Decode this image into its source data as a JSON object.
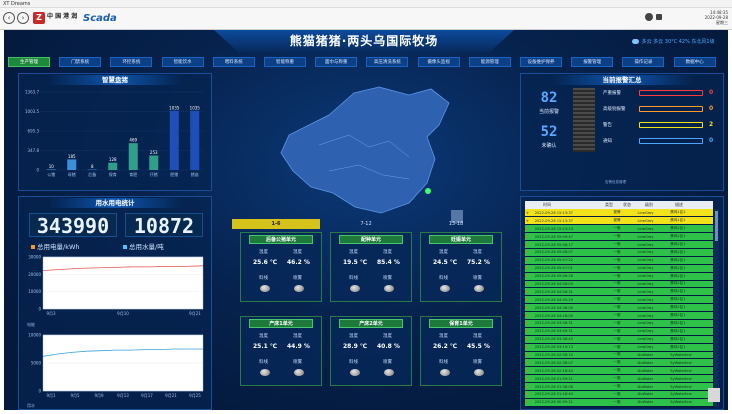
{
  "window": {
    "title": "XT Dreams"
  },
  "navbar": {
    "back_icon": "arrow-left-icon",
    "forward_icon": "arrow-right-icon",
    "logo_cn": "中 国 港 润",
    "logo_scada": "Scada",
    "time": "14:48:35",
    "date": "2022-09-28",
    "weekday": "星期三"
  },
  "header": {
    "title": "熊猫猪猪·两头乌国际牧场",
    "weather": "多云 多云 30°C 42% 东北风1级"
  },
  "tabs": [
    {
      "label": "生产管理",
      "active": true
    },
    {
      "label": "门禁系统",
      "active": false
    },
    {
      "label": "环控系统",
      "active": false
    },
    {
      "label": "智能饮水",
      "active": false
    },
    {
      "label": "喂料系统",
      "active": false
    },
    {
      "label": "智能称重",
      "active": false
    },
    {
      "label": "面巾与称重",
      "active": false
    },
    {
      "label": "高压清洗系统",
      "active": false
    },
    {
      "label": "摄像头监视",
      "active": false
    },
    {
      "label": "能源管理",
      "active": false
    },
    {
      "label": "设备维护保养",
      "active": false
    },
    {
      "label": "报警管理",
      "active": false
    },
    {
      "label": "操作记录",
      "active": false
    },
    {
      "label": "数据中心",
      "active": false
    }
  ],
  "inventory_panel": {
    "title": "智慧盘猪",
    "chart_data": {
      "type": "bar",
      "categories": [
        "公猪",
        "母猪",
        "后备",
        "保育",
        "育肥",
        "仔猪",
        "肥猪",
        "猪苗"
      ],
      "values": [
        10,
        185,
        8,
        128,
        469,
        253,
        1035,
        1035
      ],
      "y_ticks": [
        "1363.7",
        "1003.5",
        "695.3",
        "347.8",
        "0"
      ],
      "ylim": [
        0,
        1363.7
      ]
    }
  },
  "utility_panel": {
    "title": "用水用电统计",
    "power_value": "343990",
    "water_value": "10872",
    "power_label": "总用电量/kWh",
    "water_label": "总用水量/吨",
    "power_chart": {
      "type": "line",
      "y_ticks": [
        "30000",
        "20000",
        "10000",
        "0"
      ],
      "x_ticks": [
        "9月3",
        "9月10",
        "9月21"
      ],
      "unit_label": "电能"
    },
    "water_chart": {
      "type": "line",
      "y_ticks": [
        "10000",
        "5000",
        "0"
      ],
      "x_ticks": [
        "9月1",
        "9月5",
        "9月9",
        "9月13",
        "9月17",
        "9月21",
        "9月25"
      ],
      "unit_label": "用水"
    }
  },
  "alarm_counter": {
    "current_label": "当前报警",
    "current_value": "82",
    "unconfirmed_label": "未确认",
    "unconfirmed_value": "52"
  },
  "alarm_levels": [
    {
      "label": "严重报警",
      "value": "0",
      "color": "#ff3b3b"
    },
    {
      "label": "高级别报警",
      "value": "0",
      "color": "#ff9a2b"
    },
    {
      "label": "警告",
      "value": "2",
      "color": "#f2e21a"
    },
    {
      "label": "通知",
      "value": "0",
      "color": "#4aa8ff"
    }
  ],
  "alarm_levels_footer": "告警信息管理",
  "alarm_panel": {
    "title": "当前报警汇总",
    "columns": [
      "",
      "时间",
      "类型",
      "状态",
      "级别",
      "描述"
    ],
    "rows": [
      {
        "time": "2022-09-28 15:13:37",
        "type": "",
        "status": "报警",
        "level": "LineGrey",
        "desc": "蛋鸡1区1",
        "color": "yellow"
      },
      {
        "time": "2022-09-28 15:13:37",
        "type": "",
        "status": "报警",
        "level": "LineGrey",
        "desc": "蛋鸡1区1",
        "color": "yellow"
      },
      {
        "time": "2022-09-28 15:13:13",
        "type": "",
        "status": "一般",
        "level": "LineGrey",
        "desc": "蛋鸡2区1",
        "color": "green"
      },
      {
        "time": "2022-09-28 05:09:47",
        "type": "",
        "status": "一般",
        "level": "LineGrey",
        "desc": "蛋鸡2区1",
        "color": "green"
      },
      {
        "time": "2022-09-28 05:08:17",
        "type": "",
        "status": "一般",
        "level": "LineGrey",
        "desc": "蛋鸡2区1",
        "color": "green"
      },
      {
        "time": "2022-09-28 05:08:07",
        "type": "",
        "status": "一般",
        "level": "LineGrey",
        "desc": "蛋鸡2区1",
        "color": "green"
      },
      {
        "time": "2022-09-28 05:07:22",
        "type": "",
        "status": "一般",
        "level": "LineGrey",
        "desc": "蛋鸡2区1",
        "color": "green"
      },
      {
        "time": "2022-09-28 05:07:01",
        "type": "",
        "status": "一般",
        "level": "LineGrey",
        "desc": "蛋鸡2区1",
        "color": "green"
      },
      {
        "time": "2022-09-28 05:06:28",
        "type": "",
        "status": "一般",
        "level": "LineGrey",
        "desc": "蛋鸡2区1",
        "color": "green"
      },
      {
        "time": "2022-09-28 04:58:03",
        "type": "",
        "status": "一般",
        "level": "LineGrey",
        "desc": "蛋鸡2区1",
        "color": "green"
      },
      {
        "time": "2022-09-28 04:56:31",
        "type": "",
        "status": "一般",
        "level": "LineGrey",
        "desc": "蛋鸡2区1",
        "color": "green"
      },
      {
        "time": "2022-09-28 04:55:29",
        "type": "",
        "status": "一般",
        "level": "LineGrey",
        "desc": "蛋鸡2区1",
        "color": "green"
      },
      {
        "time": "2022-09-28 04:38:05",
        "type": "",
        "status": "一般",
        "level": "LineGrey",
        "desc": "蛋鸡2区1",
        "color": "green"
      },
      {
        "time": "2022-09-28 04:18:05",
        "type": "",
        "status": "一般",
        "level": "LineGrey",
        "desc": "蛋鸡2区1",
        "color": "green"
      },
      {
        "time": "2022-09-28 03:58:31",
        "type": "",
        "status": "一般",
        "level": "LineGrey",
        "desc": "蛋鸡2区1",
        "color": "green"
      },
      {
        "time": "2022-09-28 03:49:31",
        "type": "",
        "status": "一般",
        "level": "LineGrey",
        "desc": "蛋鸡2区1",
        "color": "green"
      },
      {
        "time": "2022-09-28 03:38:45",
        "type": "",
        "status": "一般",
        "level": "LineGrey",
        "desc": "蛋鸡2区1",
        "color": "green"
      },
      {
        "time": "2022-09-28 03:19:13",
        "type": "",
        "status": "一般",
        "level": "LineGrey",
        "desc": "蛋鸡2区1",
        "color": "green"
      },
      {
        "time": "2022-09-28 02:58:10",
        "type": "",
        "status": "一般",
        "level": "DuWater",
        "desc": "SyWaterline",
        "color": "green"
      },
      {
        "time": "2022-09-28 02:38:07",
        "type": "",
        "status": "一般",
        "level": "DuWater",
        "desc": "SyWaterline",
        "color": "green"
      },
      {
        "time": "2022-09-28 02:18:44",
        "type": "",
        "status": "一般",
        "level": "DuWater",
        "desc": "SyWaterline",
        "color": "green"
      },
      {
        "time": "2022-09-28 01:59:21",
        "type": "",
        "status": "一般",
        "level": "DuWater",
        "desc": "SyWaterline",
        "color": "green"
      },
      {
        "time": "2022-09-28 01:38:08",
        "type": "",
        "status": "一般",
        "level": "DuWater",
        "desc": "SyWaterline",
        "color": "green"
      },
      {
        "time": "2022-09-28 01:18:40",
        "type": "",
        "status": "一般",
        "level": "DuWater",
        "desc": "SyWaterline",
        "color": "green"
      },
      {
        "time": "2022-09-28 00:59:21",
        "type": "",
        "status": "一般",
        "level": "DuWater",
        "desc": "SyWaterline",
        "color": "green"
      },
      {
        "time": "2022-09-28 00:38:28",
        "type": "",
        "status": "一般",
        "level": "LineGrey",
        "desc": "蛋鸡2区1",
        "color": "green"
      },
      {
        "time": "2022-09-28 00:18:35",
        "type": "",
        "status": "一般",
        "level": "LineGrey",
        "desc": "蛋鸡2区1",
        "color": "green"
      }
    ]
  },
  "unit_tabs": [
    "1-6",
    "7-12",
    "13-18"
  ],
  "units": [
    {
      "title": "后备公猪单元",
      "temp_label": "温度",
      "hum_label": "湿度",
      "temp": "25.6 ℃",
      "hum": "46.2 %",
      "feed_label": "料线",
      "spray_label": "喷雾"
    },
    {
      "title": "配种单元",
      "temp_label": "温度",
      "hum_label": "湿度",
      "temp": "19.5 ℃",
      "hum": "85.4 %",
      "feed_label": "料线",
      "spray_label": "喷雾"
    },
    {
      "title": "妊娠单元",
      "temp_label": "温度",
      "hum_label": "湿度",
      "temp": "24.5 ℃",
      "hum": "75.2 %",
      "feed_label": "料线",
      "spray_label": "喷雾"
    },
    {
      "title": "产床1单元",
      "temp_label": "温度",
      "hum_label": "湿度",
      "temp": "25.1 ℃",
      "hum": "44.9 %",
      "feed_label": "料线",
      "spray_label": "喷雾"
    },
    {
      "title": "产床2单元",
      "temp_label": "温度",
      "hum_label": "湿度",
      "temp": "28.9 ℃",
      "hum": "40.8 %",
      "feed_label": "料线",
      "spray_label": "喷雾"
    },
    {
      "title": "保育1单元",
      "temp_label": "温度",
      "hum_label": "湿度",
      "temp": "26.2 ℃",
      "hum": "45.5 %",
      "feed_label": "料线",
      "spray_label": "喷雾"
    }
  ]
}
